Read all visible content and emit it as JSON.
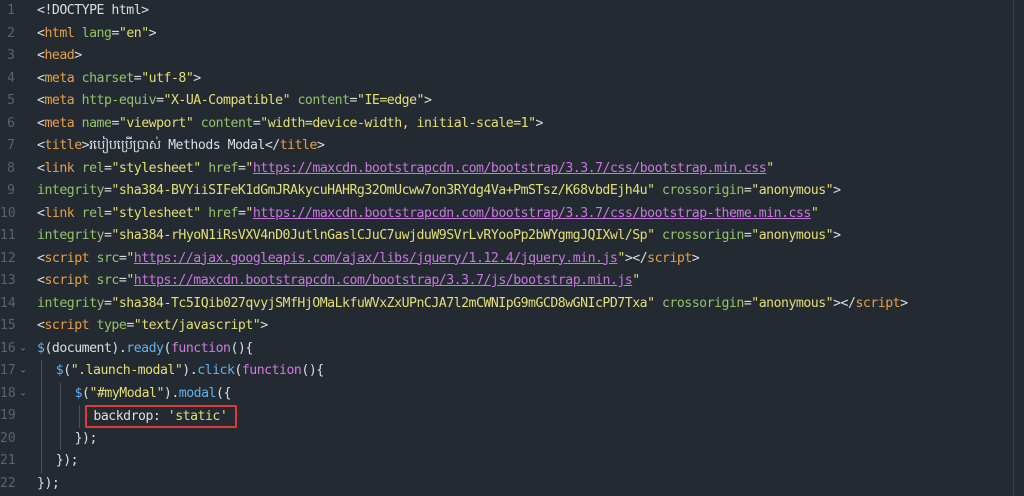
{
  "editor": {
    "lines": [
      {
        "n": "1",
        "tokens": [
          {
            "t": "<!DOCTYPE html>",
            "c": "plain"
          }
        ]
      },
      {
        "n": "2",
        "tokens": [
          {
            "t": "<",
            "c": "plain"
          },
          {
            "t": "html",
            "c": "tag"
          },
          {
            "t": " ",
            "c": "plain"
          },
          {
            "t": "lang",
            "c": "attr"
          },
          {
            "t": "=",
            "c": "plain"
          },
          {
            "t": "\"en\"",
            "c": "str"
          },
          {
            "t": ">",
            "c": "plain"
          }
        ]
      },
      {
        "n": "3",
        "tokens": [
          {
            "t": "<",
            "c": "plain"
          },
          {
            "t": "head",
            "c": "tag"
          },
          {
            "t": ">",
            "c": "plain"
          }
        ]
      },
      {
        "n": "4",
        "tokens": [
          {
            "t": "<",
            "c": "plain"
          },
          {
            "t": "meta",
            "c": "tag"
          },
          {
            "t": " ",
            "c": "plain"
          },
          {
            "t": "charset",
            "c": "attr"
          },
          {
            "t": "=",
            "c": "plain"
          },
          {
            "t": "\"utf-8\"",
            "c": "str"
          },
          {
            "t": ">",
            "c": "plain"
          }
        ]
      },
      {
        "n": "5",
        "tokens": [
          {
            "t": "<",
            "c": "plain"
          },
          {
            "t": "meta",
            "c": "tag"
          },
          {
            "t": " ",
            "c": "plain"
          },
          {
            "t": "http-equiv",
            "c": "attr"
          },
          {
            "t": "=",
            "c": "plain"
          },
          {
            "t": "\"X-UA-Compatible\"",
            "c": "str"
          },
          {
            "t": " ",
            "c": "plain"
          },
          {
            "t": "content",
            "c": "attr"
          },
          {
            "t": "=",
            "c": "plain"
          },
          {
            "t": "\"IE=edge\"",
            "c": "str"
          },
          {
            "t": ">",
            "c": "plain"
          }
        ]
      },
      {
        "n": "6",
        "tokens": [
          {
            "t": "<",
            "c": "plain"
          },
          {
            "t": "meta",
            "c": "tag"
          },
          {
            "t": " ",
            "c": "plain"
          },
          {
            "t": "name",
            "c": "attr"
          },
          {
            "t": "=",
            "c": "plain"
          },
          {
            "t": "\"viewport\"",
            "c": "str"
          },
          {
            "t": " ",
            "c": "plain"
          },
          {
            "t": "content",
            "c": "attr"
          },
          {
            "t": "=",
            "c": "plain"
          },
          {
            "t": "\"width=device-width, initial-scale=1\"",
            "c": "str"
          },
          {
            "t": ">",
            "c": "plain"
          }
        ]
      },
      {
        "n": "7",
        "tokens": [
          {
            "t": "<",
            "c": "plain"
          },
          {
            "t": "title",
            "c": "tag"
          },
          {
            "t": ">",
            "c": "plain"
          },
          {
            "t": "របៀបប្រើប្រាស់ Methods Modal",
            "c": "plain"
          },
          {
            "t": "</",
            "c": "plain"
          },
          {
            "t": "title",
            "c": "tag"
          },
          {
            "t": ">",
            "c": "plain"
          }
        ]
      },
      {
        "n": "8",
        "tokens": [
          {
            "t": "<",
            "c": "plain"
          },
          {
            "t": "link",
            "c": "tag"
          },
          {
            "t": " ",
            "c": "plain"
          },
          {
            "t": "rel",
            "c": "attr"
          },
          {
            "t": "=",
            "c": "plain"
          },
          {
            "t": "\"stylesheet\"",
            "c": "str"
          },
          {
            "t": " ",
            "c": "plain"
          },
          {
            "t": "href",
            "c": "attr"
          },
          {
            "t": "=",
            "c": "plain"
          },
          {
            "t": "\"",
            "c": "str"
          },
          {
            "t": "https://maxcdn.bootstrapcdn.com/bootstrap/3.3.7/css/bootstrap.min.css",
            "c": "link"
          },
          {
            "t": "\"",
            "c": "str"
          }
        ]
      },
      {
        "n": "9",
        "tokens": [
          {
            "t": "integrity",
            "c": "attr"
          },
          {
            "t": "=",
            "c": "plain"
          },
          {
            "t": "\"sha384-BVYiiSIFeK1dGmJRAkycuHAHRg32OmUcww7on3RYdg4Va+PmSTsz/K68vbdEjh4u\"",
            "c": "str"
          },
          {
            "t": " ",
            "c": "plain"
          },
          {
            "t": "crossorigin",
            "c": "attr"
          },
          {
            "t": "=",
            "c": "plain"
          },
          {
            "t": "\"anonymous\"",
            "c": "str"
          },
          {
            "t": ">",
            "c": "plain"
          }
        ]
      },
      {
        "n": "10",
        "tokens": [
          {
            "t": "<",
            "c": "plain"
          },
          {
            "t": "link",
            "c": "tag"
          },
          {
            "t": " ",
            "c": "plain"
          },
          {
            "t": "rel",
            "c": "attr"
          },
          {
            "t": "=",
            "c": "plain"
          },
          {
            "t": "\"stylesheet\"",
            "c": "str"
          },
          {
            "t": " ",
            "c": "plain"
          },
          {
            "t": "href",
            "c": "attr"
          },
          {
            "t": "=",
            "c": "plain"
          },
          {
            "t": "\"",
            "c": "str"
          },
          {
            "t": "https://maxcdn.bootstrapcdn.com/bootstrap/3.3.7/css/bootstrap-theme.min.css",
            "c": "link"
          },
          {
            "t": "\"",
            "c": "str"
          }
        ]
      },
      {
        "n": "11",
        "tokens": [
          {
            "t": "integrity",
            "c": "attr"
          },
          {
            "t": "=",
            "c": "plain"
          },
          {
            "t": "\"sha384-rHyoN1iRsVXV4nD0JutlnGaslCJuC7uwjduW9SVrLvRYooPp2bWYgmgJQIXwl/Sp\"",
            "c": "str"
          },
          {
            "t": " ",
            "c": "plain"
          },
          {
            "t": "crossorigin",
            "c": "attr"
          },
          {
            "t": "=",
            "c": "plain"
          },
          {
            "t": "\"anonymous\"",
            "c": "str"
          },
          {
            "t": ">",
            "c": "plain"
          }
        ]
      },
      {
        "n": "12",
        "tokens": [
          {
            "t": "<",
            "c": "plain"
          },
          {
            "t": "script",
            "c": "tag"
          },
          {
            "t": " ",
            "c": "plain"
          },
          {
            "t": "src",
            "c": "attr"
          },
          {
            "t": "=",
            "c": "plain"
          },
          {
            "t": "\"",
            "c": "str"
          },
          {
            "t": "https://ajax.googleapis.com/ajax/libs/jquery/1.12.4/jquery.min.js",
            "c": "link"
          },
          {
            "t": "\"",
            "c": "str"
          },
          {
            "t": "></",
            "c": "plain"
          },
          {
            "t": "script",
            "c": "tag"
          },
          {
            "t": ">",
            "c": "plain"
          }
        ]
      },
      {
        "n": "13",
        "tokens": [
          {
            "t": "<",
            "c": "plain"
          },
          {
            "t": "script",
            "c": "tag"
          },
          {
            "t": " ",
            "c": "plain"
          },
          {
            "t": "src",
            "c": "attr"
          },
          {
            "t": "=",
            "c": "plain"
          },
          {
            "t": "\"",
            "c": "str"
          },
          {
            "t": "https://maxcdn.bootstrapcdn.com/bootstrap/3.3.7/js/bootstrap.min.js",
            "c": "link"
          },
          {
            "t": "\"",
            "c": "str"
          }
        ]
      },
      {
        "n": "14",
        "tokens": [
          {
            "t": "integrity",
            "c": "attr"
          },
          {
            "t": "=",
            "c": "plain"
          },
          {
            "t": "\"sha384-Tc5IQib027qvyjSMfHjOMaLkfuWVxZxUPnCJA7l2mCWNIpG9mGCD8wGNIcPD7Txa\"",
            "c": "str"
          },
          {
            "t": " ",
            "c": "plain"
          },
          {
            "t": "crossorigin",
            "c": "attr"
          },
          {
            "t": "=",
            "c": "plain"
          },
          {
            "t": "\"anonymous\"",
            "c": "str"
          },
          {
            "t": "></",
            "c": "plain"
          },
          {
            "t": "script",
            "c": "tag"
          },
          {
            "t": ">",
            "c": "plain"
          }
        ]
      },
      {
        "n": "15",
        "tokens": [
          {
            "t": "<",
            "c": "plain"
          },
          {
            "t": "script",
            "c": "tag"
          },
          {
            "t": " ",
            "c": "plain"
          },
          {
            "t": "type",
            "c": "attr"
          },
          {
            "t": "=",
            "c": "plain"
          },
          {
            "t": "\"text/javascript\"",
            "c": "str"
          },
          {
            "t": ">",
            "c": "plain"
          }
        ]
      },
      {
        "n": "16",
        "fold": true,
        "tokens": [
          {
            "t": "$",
            "c": "func"
          },
          {
            "t": "(document).",
            "c": "plain"
          },
          {
            "t": "ready",
            "c": "func"
          },
          {
            "t": "(",
            "c": "plain"
          },
          {
            "t": "function",
            "c": "kw"
          },
          {
            "t": "(){",
            "c": "plain"
          }
        ]
      },
      {
        "n": "17",
        "fold": true,
        "indent": 1,
        "tokens": [
          {
            "t": "$",
            "c": "func"
          },
          {
            "t": "(",
            "c": "plain"
          },
          {
            "t": "\".launch-modal\"",
            "c": "str"
          },
          {
            "t": ").",
            "c": "plain"
          },
          {
            "t": "click",
            "c": "func"
          },
          {
            "t": "(",
            "c": "plain"
          },
          {
            "t": "function",
            "c": "kw"
          },
          {
            "t": "(){",
            "c": "plain"
          }
        ]
      },
      {
        "n": "18",
        "fold": true,
        "indent": 2,
        "tokens": [
          {
            "t": "$",
            "c": "func"
          },
          {
            "t": "(",
            "c": "plain"
          },
          {
            "t": "\"#myModal\"",
            "c": "str"
          },
          {
            "t": ").",
            "c": "plain"
          },
          {
            "t": "modal",
            "c": "func"
          },
          {
            "t": "({",
            "c": "plain"
          }
        ]
      },
      {
        "n": "19",
        "indent": 3,
        "highlight": true,
        "tokens": [
          {
            "t": "backdrop: ",
            "c": "plain"
          },
          {
            "t": "'static'",
            "c": "str"
          }
        ]
      },
      {
        "n": "20",
        "indent": 2,
        "tokens": [
          {
            "t": "});",
            "c": "plain"
          }
        ]
      },
      {
        "n": "21",
        "indent": 1,
        "tokens": [
          {
            "t": "});",
            "c": "plain"
          }
        ]
      },
      {
        "n": "22",
        "indent": 0,
        "tokens": [
          {
            "t": "});",
            "c": "plain"
          }
        ]
      }
    ]
  }
}
